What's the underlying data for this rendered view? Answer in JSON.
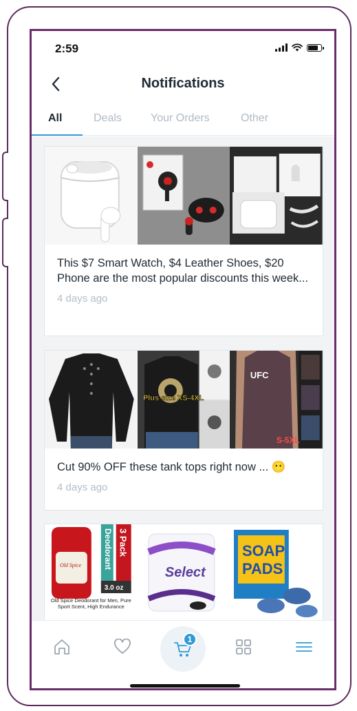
{
  "status_bar": {
    "time": "2:59"
  },
  "header": {
    "title": "Notifications"
  },
  "tabs": [
    {
      "label": "All",
      "active": true
    },
    {
      "label": "Deals",
      "active": false
    },
    {
      "label": "Your Orders",
      "active": false
    },
    {
      "label": "Other",
      "active": false
    }
  ],
  "notifications": [
    {
      "text": "This $7 Smart Watch, $4 Leather Shoes, $20 Phone are the most popular discounts this week...",
      "time": "4 days ago",
      "images": [
        "earbuds-white",
        "earbuds-red-black",
        "earbuds-box"
      ]
    },
    {
      "text": "Cut 90% OFF these tank tops right now ... 😶",
      "time": "4 days ago",
      "images": [
        "black-henley-shirt",
        "printed-tshirts",
        "ufc-tank-top"
      ],
      "image_labels": {
        "plus_size": "Plus size XS-4XL",
        "ufc": "UFC",
        "size_range": "S-5XL"
      }
    },
    {
      "text": "",
      "time": "",
      "images": [
        "deodorant",
        "paper-towels",
        "soap-pads"
      ],
      "image_labels": {
        "deodorant_pack": "3 Pack",
        "deodorant_word": "Deodorant",
        "deodorant_size": "3.0 oz",
        "deodorant_caption": "Old Spice Deodorant for Men, Pure Sport Scent, High Endurance",
        "towel_brand": "Select",
        "soap_word1": "SOAP",
        "soap_word2": "PADS"
      }
    }
  ],
  "bottom_nav": {
    "items": [
      "home-icon",
      "heart-icon",
      "cart-icon",
      "grid-icon",
      "menu-icon"
    ],
    "cart_count": "1",
    "active_color": "#2e9bd6"
  }
}
